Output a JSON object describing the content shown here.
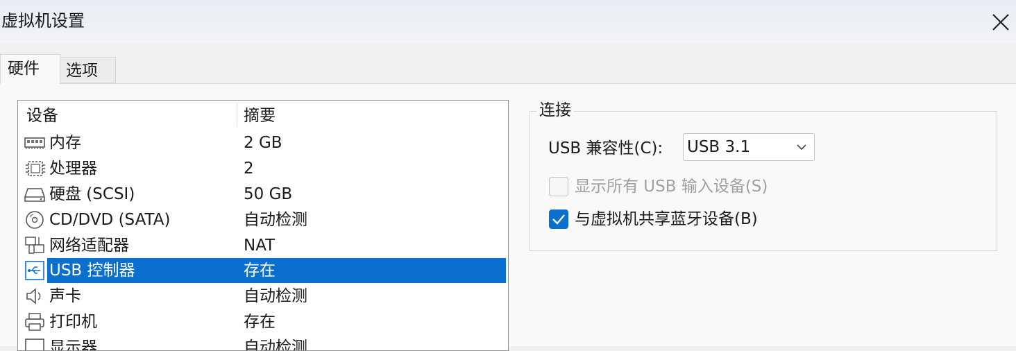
{
  "window": {
    "title": "虚拟机设置"
  },
  "tabs": [
    {
      "label": "硬件"
    },
    {
      "label": "选项"
    }
  ],
  "device_list": {
    "columns": {
      "device": "设备",
      "summary": "摘要"
    },
    "rows": [
      {
        "icon": "memory-icon",
        "name": "内存",
        "summary": "2 GB"
      },
      {
        "icon": "processor-icon",
        "name": "处理器",
        "summary": "2"
      },
      {
        "icon": "hard-disk-icon",
        "name": "硬盘 (SCSI)",
        "summary": "50 GB"
      },
      {
        "icon": "cd-dvd-icon",
        "name": "CD/DVD (SATA)",
        "summary": "自动检测"
      },
      {
        "icon": "network-adapter-icon",
        "name": "网络适配器",
        "summary": "NAT"
      },
      {
        "icon": "usb-icon",
        "name": "USB 控制器",
        "summary": "存在",
        "selected": true
      },
      {
        "icon": "speaker-icon",
        "name": "声卡",
        "summary": "自动检测"
      },
      {
        "icon": "printer-icon",
        "name": "打印机",
        "summary": "存在"
      },
      {
        "icon": "display-icon",
        "name": "显示器",
        "summary": "自动检测"
      }
    ]
  },
  "connection": {
    "group_title": "连接",
    "usb_compat_label": "USB 兼容性(C):",
    "usb_compat_value": "USB 3.1",
    "show_all_usb_label": "显示所有 USB 输入设备(S)",
    "show_all_usb_checked": false,
    "show_all_usb_enabled": false,
    "share_bluetooth_label": "与虚拟机共享蓝牙设备(B)",
    "share_bluetooth_checked": true
  },
  "colors": {
    "selection": "#0b6fd0",
    "checkbox_checked": "#0b6fd0",
    "disabled_text": "#a0a0a0"
  }
}
